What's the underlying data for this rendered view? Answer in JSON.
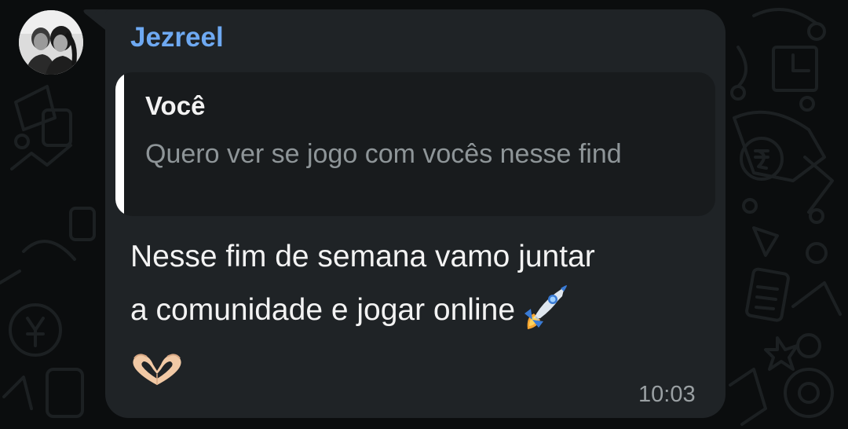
{
  "chat": {
    "sender_name": "Jezreel",
    "sender_avatar": "avatar-photo",
    "reply": {
      "author": "Você",
      "text": "Quero ver se jogo com vocês nesse find"
    },
    "message": {
      "line1": "Nesse fim de semana vamo juntar",
      "line2": "a comunidade e jogar online",
      "emoji_inline": "rocket-emoji",
      "emoji_trailing": "heart-hands-emoji"
    },
    "time": "10:03"
  },
  "colors": {
    "bubble": "#1f2326",
    "quote_bg": "#181b1d",
    "sender_name": "#6ea9f2",
    "background": "#0b0d0e"
  }
}
